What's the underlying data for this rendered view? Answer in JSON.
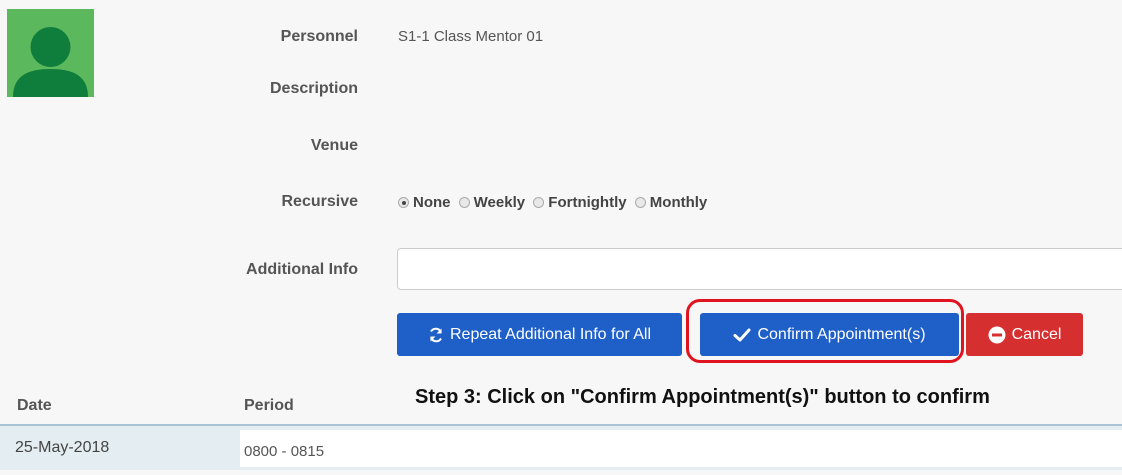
{
  "form": {
    "personnel_label": "Personnel",
    "personnel_value": "S1-1 Class Mentor 01",
    "description_label": "Description",
    "venue_label": "Venue",
    "recursive_label": "Recursive",
    "recursive_options": [
      "None",
      "Weekly",
      "Fortnightly",
      "Monthly"
    ],
    "recursive_selected": "None",
    "additional_info_label": "Additional Info",
    "additional_info_value": ""
  },
  "buttons": {
    "repeat_label": "Repeat Additional Info for All",
    "confirm_label": "Confirm Appointment(s)",
    "cancel_label": "Cancel"
  },
  "annotation": {
    "step_text": "Step 3: Click on \"Confirm Appointment(s)\" button to confirm",
    "highlight_color": "#e0141e"
  },
  "table": {
    "headers": [
      "Date",
      "Period"
    ],
    "rows": [
      {
        "date": "25-May-2018",
        "period": "0800 - 0815"
      }
    ]
  },
  "colors": {
    "avatar_bg": "#5cb85c",
    "primary_button": "#1f5fc8",
    "danger_button": "#d62f2f"
  },
  "icons": {
    "avatar": "user-silhouette-icon",
    "repeat": "refresh-icon",
    "confirm": "checkmark-icon",
    "cancel": "minus-circle-icon"
  }
}
